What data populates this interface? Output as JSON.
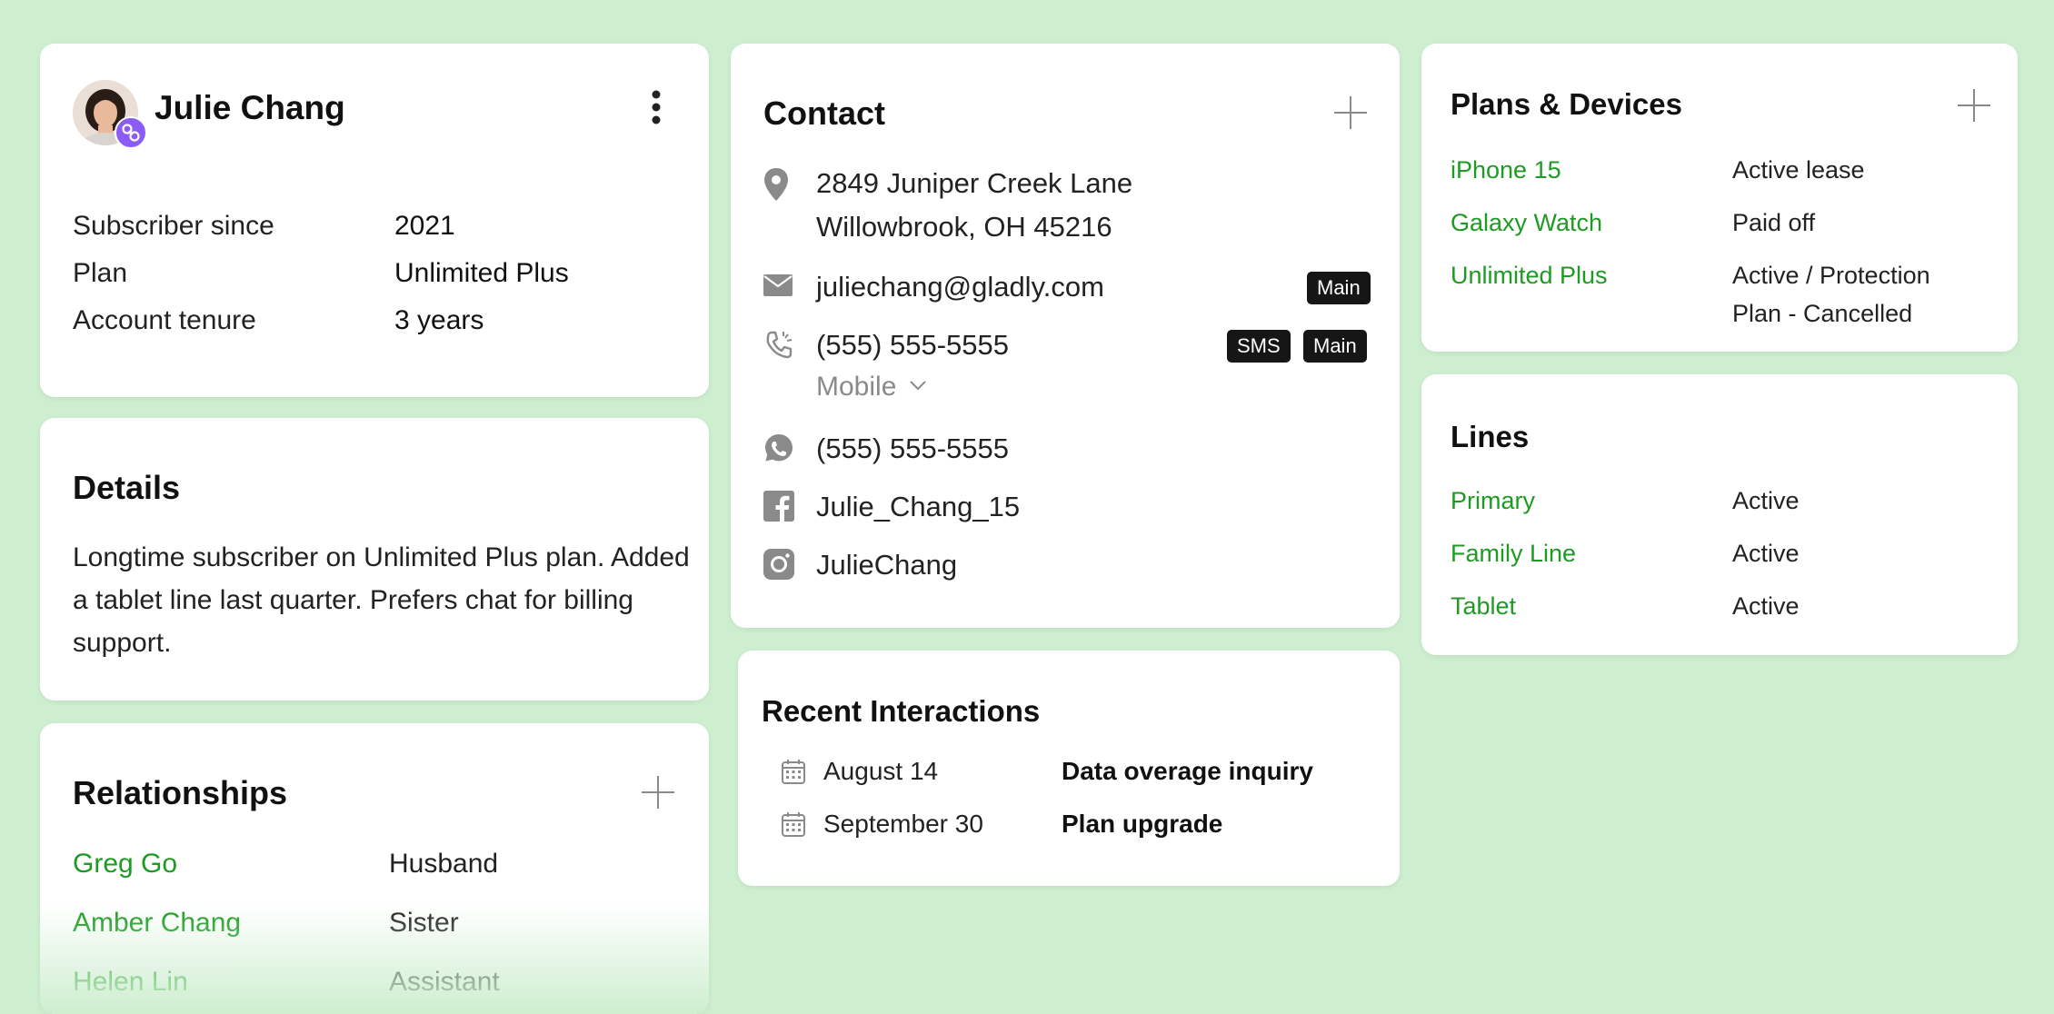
{
  "profile": {
    "name": "Julie Chang",
    "rows": [
      {
        "label": "Subscriber since",
        "value": "2021"
      },
      {
        "label": "Plan",
        "value": "Unlimited Plus"
      },
      {
        "label": "Account tenure",
        "value": "3 years"
      }
    ]
  },
  "details": {
    "title": "Details",
    "text": "Longtime subscriber on Unlimited Plus plan. Added a tablet line last quarter. Prefers chat for billing support."
  },
  "relationships": {
    "title": "Relationships",
    "items": [
      {
        "name": "Greg Go",
        "relation": "Husband"
      },
      {
        "name": "Amber Chang",
        "relation": "Sister"
      },
      {
        "name": "Helen Lin",
        "relation": "Assistant"
      }
    ]
  },
  "contact": {
    "title": "Contact",
    "address_line1": "2849 Juniper Creek Lane",
    "address_line2": "Willowbrook, OH 45216",
    "email": "juliechang@gladly.com",
    "email_badge": "Main",
    "phone": "(555) 555-5555",
    "phone_badge_sms": "SMS",
    "phone_badge_main": "Main",
    "phone_type": "Mobile",
    "whatsapp": "(555) 555-5555",
    "facebook": "Julie_Chang_15",
    "instagram": "JulieChang"
  },
  "interactions": {
    "title": "Recent Interactions",
    "items": [
      {
        "date": "August 14",
        "subject": "Data overage inquiry"
      },
      {
        "date": "September 30",
        "subject": "Plan upgrade"
      }
    ]
  },
  "plans": {
    "title": "Plans & Devices",
    "items": [
      {
        "name": "iPhone 15",
        "status": "Active lease"
      },
      {
        "name": "Galaxy Watch",
        "status": "Paid off"
      },
      {
        "name": "Unlimited Plus",
        "status_line1": "Active / Protection",
        "status_line2": "Plan - Cancelled"
      }
    ]
  },
  "lines": {
    "title": "Lines",
    "items": [
      {
        "name": "Primary",
        "status": "Active"
      },
      {
        "name": "Family Line",
        "status": "Active"
      },
      {
        "name": "Tablet",
        "status": "Active"
      }
    ]
  },
  "colors": {
    "background": "#cdeecf",
    "link_green": "#1d9b22",
    "badge": "#161616",
    "avatar_badge": "#8b5cf6"
  },
  "icons": [
    "kebab-menu-icon",
    "link-icon",
    "plus-icon",
    "location-pin-icon",
    "mail-icon",
    "phone-icon",
    "chevron-down-icon",
    "whatsapp-icon",
    "facebook-icon",
    "instagram-icon",
    "calendar-icon"
  ]
}
